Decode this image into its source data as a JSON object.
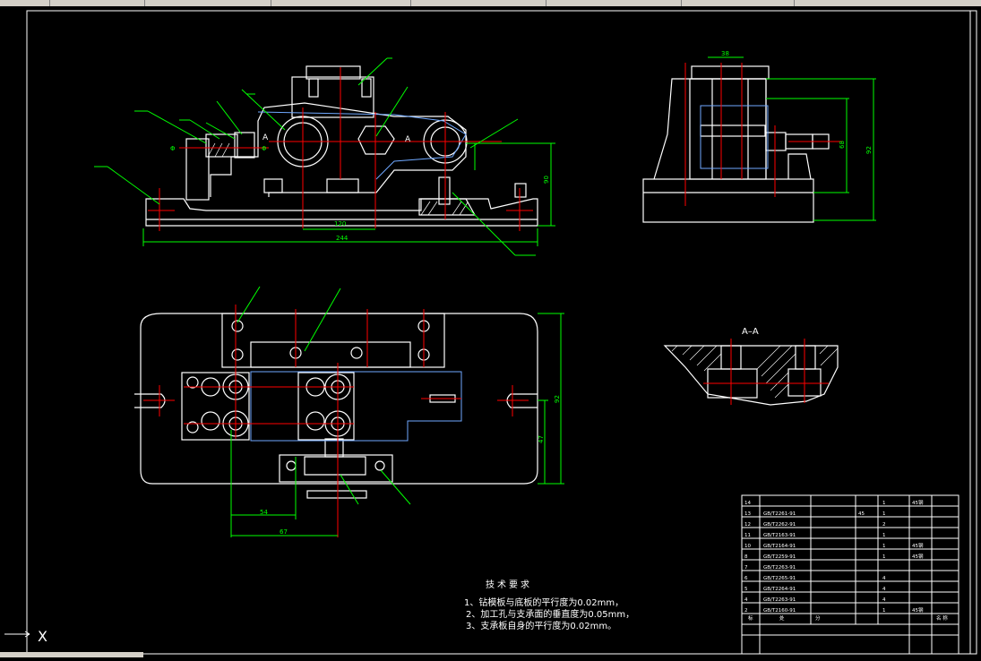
{
  "window": {
    "canvas_bg": "#000000",
    "line_color": "#ffffff",
    "center_color": "#ff0000",
    "dim_color": "#00ff00",
    "hidden_color": "#6fa8ff"
  },
  "views": {
    "section_label": "A–A",
    "marker_left": "A",
    "marker_right": "A"
  },
  "technical_requirements": {
    "title": "技术要求",
    "items": [
      "1、钻模板与底板的平行度为0.02mm，",
      "2、加工孔与支承面的垂直度为0.05mm，",
      "3、支承板自身的平行度为0.02mm。"
    ]
  },
  "ucs": {
    "x_label": "X"
  }
}
